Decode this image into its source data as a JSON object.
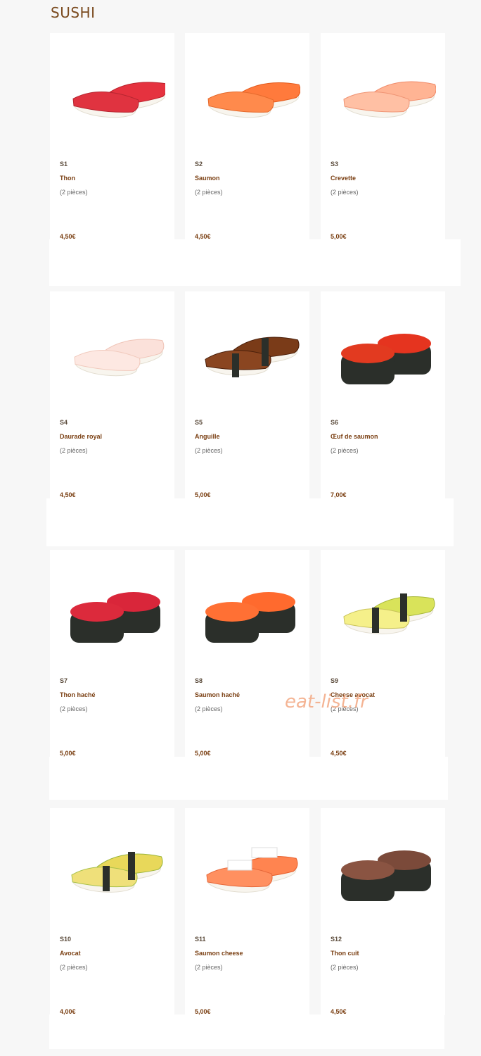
{
  "page": {
    "title": "SUSHI"
  },
  "watermark_text": "eat-list.fr",
  "items": [
    {
      "code": "S1",
      "name": "Thon",
      "pieces": "(2 pièces)",
      "price": "4,50€",
      "icon": "tuna-nigiri"
    },
    {
      "code": "S2",
      "name": "Saumon",
      "pieces": "(2 pièces)",
      "price": "4,50€",
      "icon": "salmon-nigiri"
    },
    {
      "code": "S3",
      "name": "Crevette",
      "pieces": "(2 pièces)",
      "price": "5,00€",
      "icon": "shrimp-nigiri"
    },
    {
      "code": "S4",
      "name": "Daurade royal",
      "pieces": "(2 pièces)",
      "price": "4,50€",
      "icon": "sea-bream-nigiri"
    },
    {
      "code": "S5",
      "name": "Anguille",
      "pieces": "(2 pièces)",
      "price": "5,00€",
      "icon": "eel-nigiri"
    },
    {
      "code": "S6",
      "name": "Œuf de saumon",
      "pieces": "(2 pièces)",
      "price": "7,00€",
      "icon": "salmon-roe-gunkan"
    },
    {
      "code": "S7",
      "name": "Thon haché",
      "pieces": "(2 pièces)",
      "price": "5,00€",
      "icon": "chopped-tuna-gunkan"
    },
    {
      "code": "S8",
      "name": "Saumon haché",
      "pieces": "(2 pièces)",
      "price": "5,00€",
      "icon": "chopped-salmon-gunkan"
    },
    {
      "code": "S9",
      "name": "Cheese avocat",
      "pieces": "(2 pièces)",
      "price": "4,50€",
      "icon": "cheese-avocado-nigiri"
    },
    {
      "code": "S10",
      "name": "Avocat",
      "pieces": "(2 pièces)",
      "price": "4,00€",
      "icon": "avocado-nigiri"
    },
    {
      "code": "S11",
      "name": "Saumon cheese",
      "pieces": "(2 pièces)",
      "price": "5,00€",
      "icon": "salmon-cheese-nigiri"
    },
    {
      "code": "S12",
      "name": "Thon cuit",
      "pieces": "(2 pièces)",
      "price": "4,50€",
      "icon": "cooked-tuna-gunkan"
    }
  ],
  "colors": {
    "title": "#7a4a1e",
    "price": "#7a3f12",
    "background": "#f7f7f7",
    "card": "#ffffff",
    "watermark": "#f3a882"
  }
}
